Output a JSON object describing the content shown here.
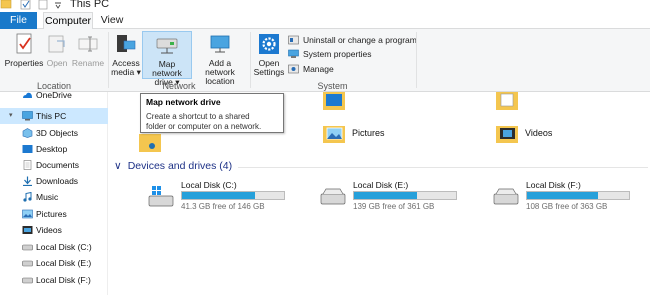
{
  "window": {
    "title": "This PC"
  },
  "ribbon_tabs": [
    "File",
    "Computer",
    "View"
  ],
  "ribbon": {
    "location": {
      "label": "Location",
      "properties": "Properties",
      "open": "Open",
      "rename": "Rename"
    },
    "network": {
      "label": "Network",
      "access_media_l1": "Access",
      "access_media_l2": "media ▾",
      "map_drive_l1": "Map network",
      "map_drive_l2": "drive ▾",
      "add_location_l1": "Add a network",
      "add_location_l2": "location"
    },
    "system": {
      "label": "System",
      "open_settings_l1": "Open",
      "open_settings_l2": "Settings",
      "uninstall": "Uninstall or change a program",
      "system_properties": "System properties",
      "manage": "Manage"
    }
  },
  "tooltip": {
    "title": "Map network drive",
    "body_l1": "Create a shortcut to a shared",
    "body_l2": "folder or computer on a network."
  },
  "nav": {
    "onedrive": "OneDrive",
    "this_pc": "This PC",
    "items": [
      "3D Objects",
      "Desktop",
      "Documents",
      "Downloads",
      "Music",
      "Pictures",
      "Videos",
      "Local Disk (C:)",
      "Local Disk (E:)",
      "Local Disk (F:)"
    ]
  },
  "folders": {
    "pictures": "Pictures",
    "videos": "Videos"
  },
  "devices_header": "Devices and drives (4)",
  "drives": [
    {
      "name": "Local Disk (C:)",
      "free": "41.3 GB free of 146 GB",
      "used_fraction": 0.72
    },
    {
      "name": "Local Disk (E:)",
      "free": "139 GB free of 361 GB",
      "used_fraction": 0.62
    },
    {
      "name": "Local Disk (F:)",
      "free": "108 GB free of 363 GB",
      "used_fraction": 0.7
    }
  ],
  "colors": {
    "file_tab": "#1979ca",
    "selection": "#cce8ff",
    "drive_bar": "#26a0da",
    "section_header": "#1e3287"
  }
}
